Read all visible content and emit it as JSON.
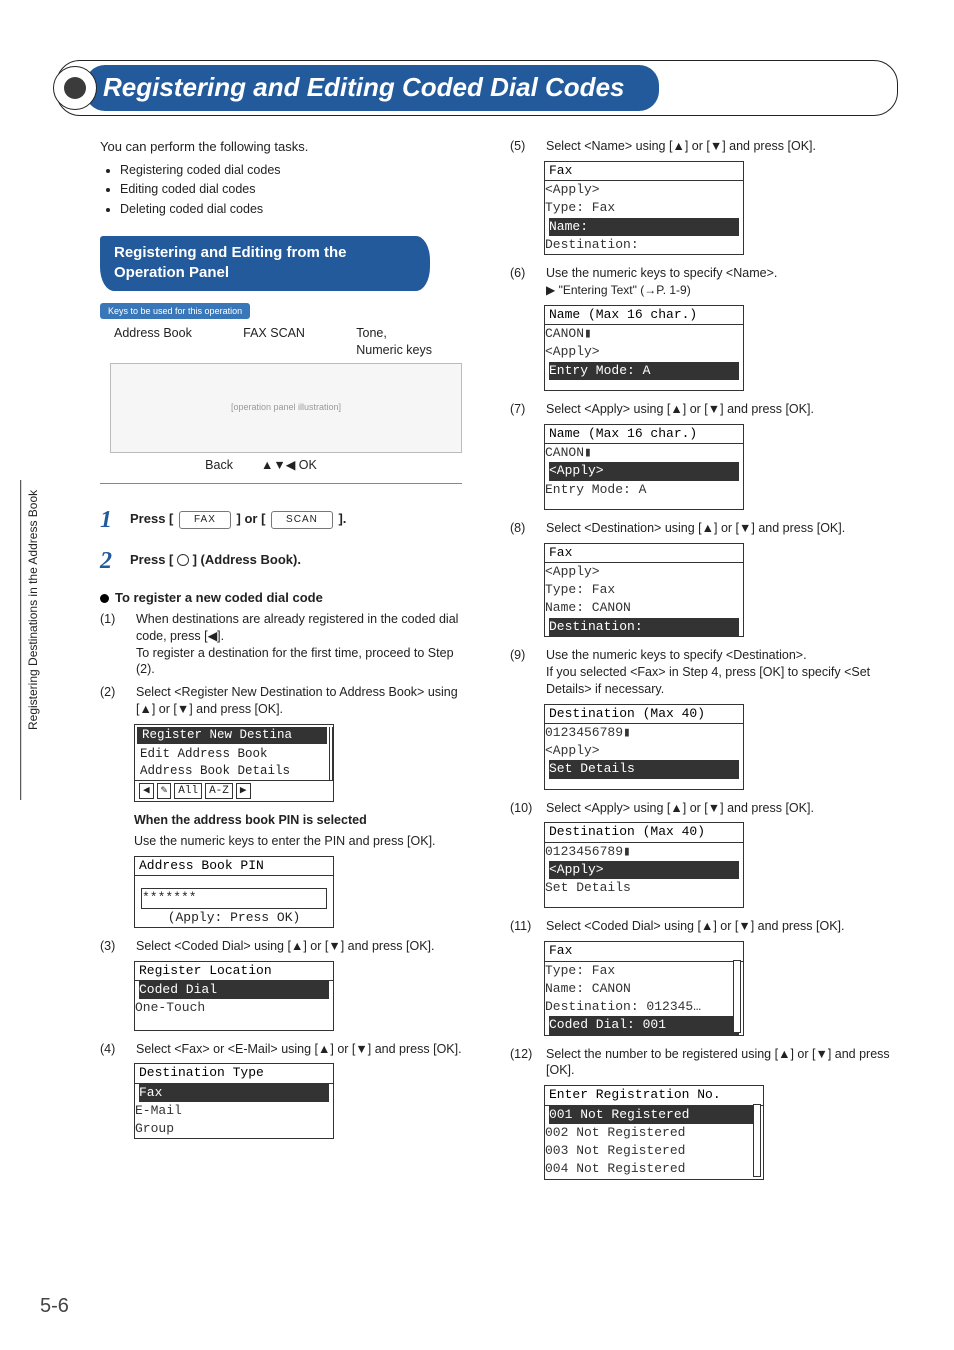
{
  "header": {
    "title": "Registering and Editing Coded Dial Codes"
  },
  "intro": "You can perform the following tasks.",
  "bullets": [
    "Registering coded dial codes",
    "Editing coded dial codes",
    "Deleting coded dial codes"
  ],
  "subhead": "Registering and Editing from the Operation Panel",
  "keys_used": {
    "tag": "Keys to be used for this operation",
    "labels_top": [
      "Address Book",
      "FAX SCAN",
      "Tone,",
      "Numeric keys"
    ],
    "labels_bottom": [
      "Back",
      "▲▼◀ OK"
    ]
  },
  "steps": {
    "s1_prefix": "Press [",
    "s1_mid": "] or [",
    "s1_suffix": "].",
    "s1_btn1": "FAX",
    "s1_btn2": "SCAN",
    "s2": "Press [        ] (Address Book)."
  },
  "register_heading": "To register a new coded dial code",
  "num1": {
    "n": "(1)",
    "t1": "When destinations are already registered in the coded dial code, press [◀].",
    "t2": "To register a destination for the first time, proceed to Step (2)."
  },
  "num2": {
    "n": "(2)",
    "t": "Select <Register New Destination to Address Book> using [▲] or [▼] and press [OK]."
  },
  "lcd_register": {
    "l1": "Register New Destina",
    "l2": "Edit Address Book",
    "l3": "Address Book Details",
    "btns": [
      "◀",
      "✎",
      "All",
      "A-Z",
      "▶"
    ]
  },
  "pin_note_head": "When the address book PIN is selected",
  "pin_note_body": "Use the numeric keys to enter the PIN and press [OK].",
  "lcd_pin": {
    "title": "Address Book PIN",
    "val": "*******",
    "foot": "(Apply: Press OK)"
  },
  "num3": {
    "n": "(3)",
    "t": "Select <Coded Dial> using [▲] or [▼] and press [OK]."
  },
  "lcd_loc": {
    "title": "Register Location",
    "sel": "Coded Dial",
    "l2": "One-Touch"
  },
  "num4": {
    "n": "(4)",
    "t": "Select <Fax> or <E-Mail> using [▲] or [▼] and press [OK]."
  },
  "lcd_dest_type": {
    "title": "Destination Type",
    "sel": "Fax",
    "l2": "E-Mail",
    "l3": "Group"
  },
  "r5": {
    "n": "(5)",
    "t": "Select <Name> using [▲] or [▼] and press [OK]."
  },
  "lcd_fax1": {
    "title": "Fax",
    "l1": "<Apply>",
    "l2": "Type: Fax",
    "sel": "Name:",
    "l4": "Destination:"
  },
  "r6": {
    "n": "(6)",
    "t": "Use the numeric keys to specify <Name>."
  },
  "xref": "▶ \"Entering Text\" (→P. 1-9)",
  "lcd_name1": {
    "title": "Name (Max 16 char.)",
    "l1": "CANON▮",
    "l2": "<Apply>",
    "sel": "Entry Mode: A"
  },
  "r7": {
    "n": "(7)",
    "t": "Select <Apply> using [▲] or [▼] and press [OK]."
  },
  "lcd_name2": {
    "title": "Name (Max 16 char.)",
    "l1": "CANON▮",
    "sel": "<Apply>",
    "l3": "Entry Mode: A"
  },
  "r8": {
    "n": "(8)",
    "t": "Select <Destination> using [▲] or [▼] and press [OK]."
  },
  "lcd_fax2": {
    "title": "Fax",
    "l1": "<Apply>",
    "l2": "Type: Fax",
    "l3": "Name: CANON",
    "sel": "Destination:"
  },
  "r9": {
    "n": "(9)",
    "t": "Use the numeric keys to specify <Destination>.",
    "t2": "If you selected <Fax> in Step 4, press [OK] to specify <Set Details> if necessary."
  },
  "lcd_dest1": {
    "title": "Destination (Max 40)",
    "l1": "0123456789▮",
    "l2": "<Apply>",
    "sel": "Set Details"
  },
  "r10": {
    "n": "(10)",
    "t": "Select <Apply> using [▲] or [▼] and press [OK]."
  },
  "lcd_dest2": {
    "title": "Destination (Max 40)",
    "l1": "0123456789▮",
    "sel": "<Apply>",
    "l3": "Set Details"
  },
  "r11": {
    "n": "(11)",
    "t": "Select <Coded Dial> using [▲] or [▼] and press [OK]."
  },
  "lcd_fax3": {
    "title": "Fax",
    "l1": "Type: Fax",
    "l2": "Name: CANON",
    "l3": "Destination: 012345…",
    "sel": "Coded Dial: 001"
  },
  "r12": {
    "n": "(12)",
    "t": "Select the number to be registered using [▲] or [▼] and press [OK]."
  },
  "lcd_reg": {
    "title": "Enter Registration No.",
    "sel": "001 Not Registered",
    "l2": "002 Not Registered",
    "l3": "003 Not Registered",
    "l4": "004 Not Registered"
  },
  "side_tab": "Registering Destinations in the Address Book",
  "page_num": "5-6"
}
